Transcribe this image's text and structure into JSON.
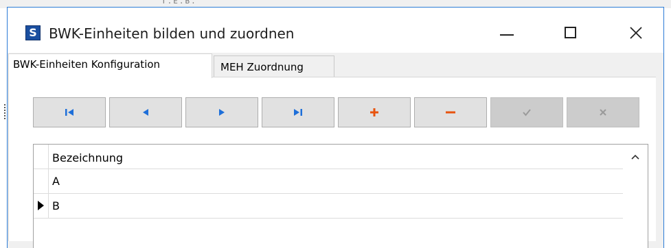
{
  "window": {
    "title": "BWK-Einheiten bilden und zuordnen",
    "icon_letter": "S"
  },
  "background_fragment": "T.E.B.",
  "tabs": [
    {
      "label": "BWK-Einheiten Konfiguration",
      "active": true
    },
    {
      "label": "MEH Zuordnung",
      "active": false
    }
  ],
  "toolbar": {
    "buttons": [
      {
        "name": "first-record-button",
        "icon": "first-record-icon",
        "enabled": true,
        "color": "#1e6fd9"
      },
      {
        "name": "prior-record-button",
        "icon": "prior-record-icon",
        "enabled": true,
        "color": "#1e6fd9"
      },
      {
        "name": "next-record-button",
        "icon": "next-record-icon",
        "enabled": true,
        "color": "#1e6fd9"
      },
      {
        "name": "last-record-button",
        "icon": "last-record-icon",
        "enabled": true,
        "color": "#1e6fd9"
      },
      {
        "name": "insert-record-button",
        "icon": "plus-icon",
        "enabled": true,
        "color": "#e8530e"
      },
      {
        "name": "delete-record-button",
        "icon": "minus-icon",
        "enabled": true,
        "color": "#e8530e"
      },
      {
        "name": "post-record-button",
        "icon": "check-icon",
        "enabled": false,
        "color": "#9a9a9a"
      },
      {
        "name": "cancel-record-button",
        "icon": "cancel-icon",
        "enabled": false,
        "color": "#9a9a9a"
      }
    ]
  },
  "grid": {
    "column_header": "Bezeichnung",
    "rows": [
      {
        "value": "A"
      },
      {
        "value": "B",
        "current": true
      }
    ]
  }
}
